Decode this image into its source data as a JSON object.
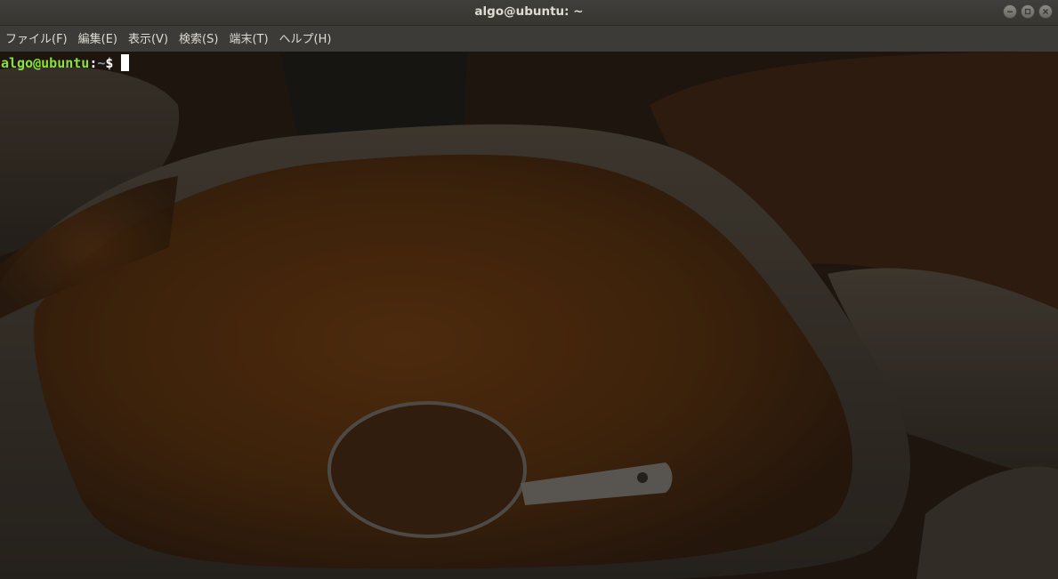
{
  "window": {
    "title": "algo@ubuntu: ~",
    "controls": [
      "minimize-icon",
      "maximize-icon",
      "close-icon"
    ]
  },
  "menu": {
    "items": [
      {
        "label": "ファイル(F)"
      },
      {
        "label": "編集(E)"
      },
      {
        "label": "表示(V)"
      },
      {
        "label": "検索(S)"
      },
      {
        "label": "端末(T)"
      },
      {
        "label": "ヘルプ(H)"
      }
    ]
  },
  "terminal": {
    "prompt_user": "algo@ubuntu",
    "prompt_colon": ":",
    "prompt_path": "~",
    "prompt_symbol": "$",
    "input": ""
  },
  "colors": {
    "prompt_user": "#8ae234",
    "prompt_path": "#729fcf",
    "titlebar": "#3c3b37",
    "text": "#dfdbd2"
  }
}
